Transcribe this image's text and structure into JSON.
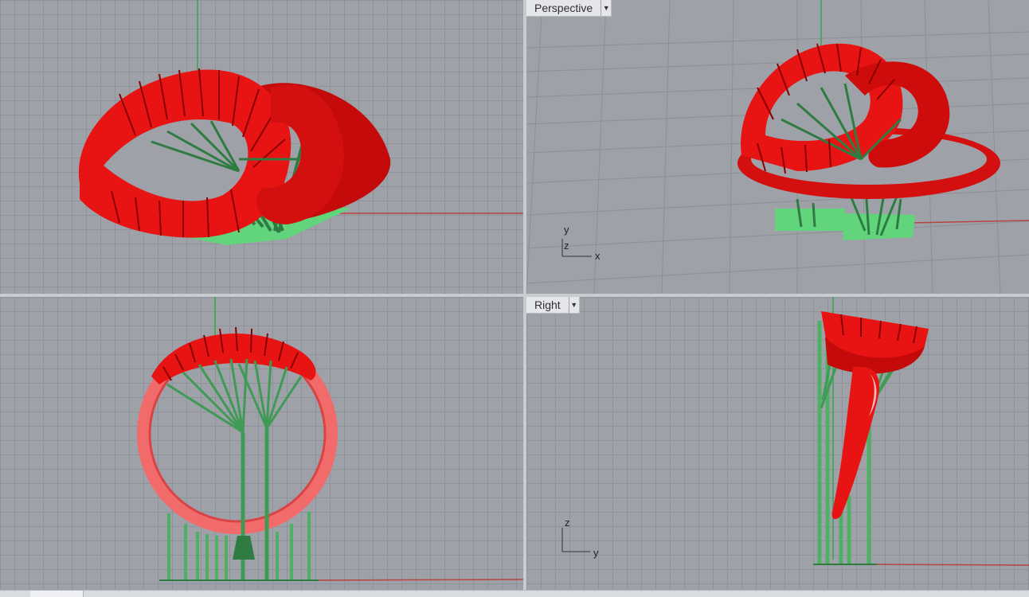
{
  "viewports": {
    "top_left": {
      "label": ""
    },
    "top_right": {
      "label": "Perspective",
      "axis_labels": {
        "y": "y",
        "z": "z",
        "x": "x"
      }
    },
    "bottom_left": {
      "label": ""
    },
    "bottom_right": {
      "label": "Right",
      "axis_labels": {
        "z": "z",
        "y": "y"
      }
    }
  },
  "icons": {
    "dropdown": "chevron-down-icon"
  },
  "colors": {
    "viewport_bg": "#9ea2a8",
    "model_red": "#e81414",
    "support_green": "#3f9a55",
    "axis_green": "#34a84a",
    "axis_red": "#b8433f"
  }
}
